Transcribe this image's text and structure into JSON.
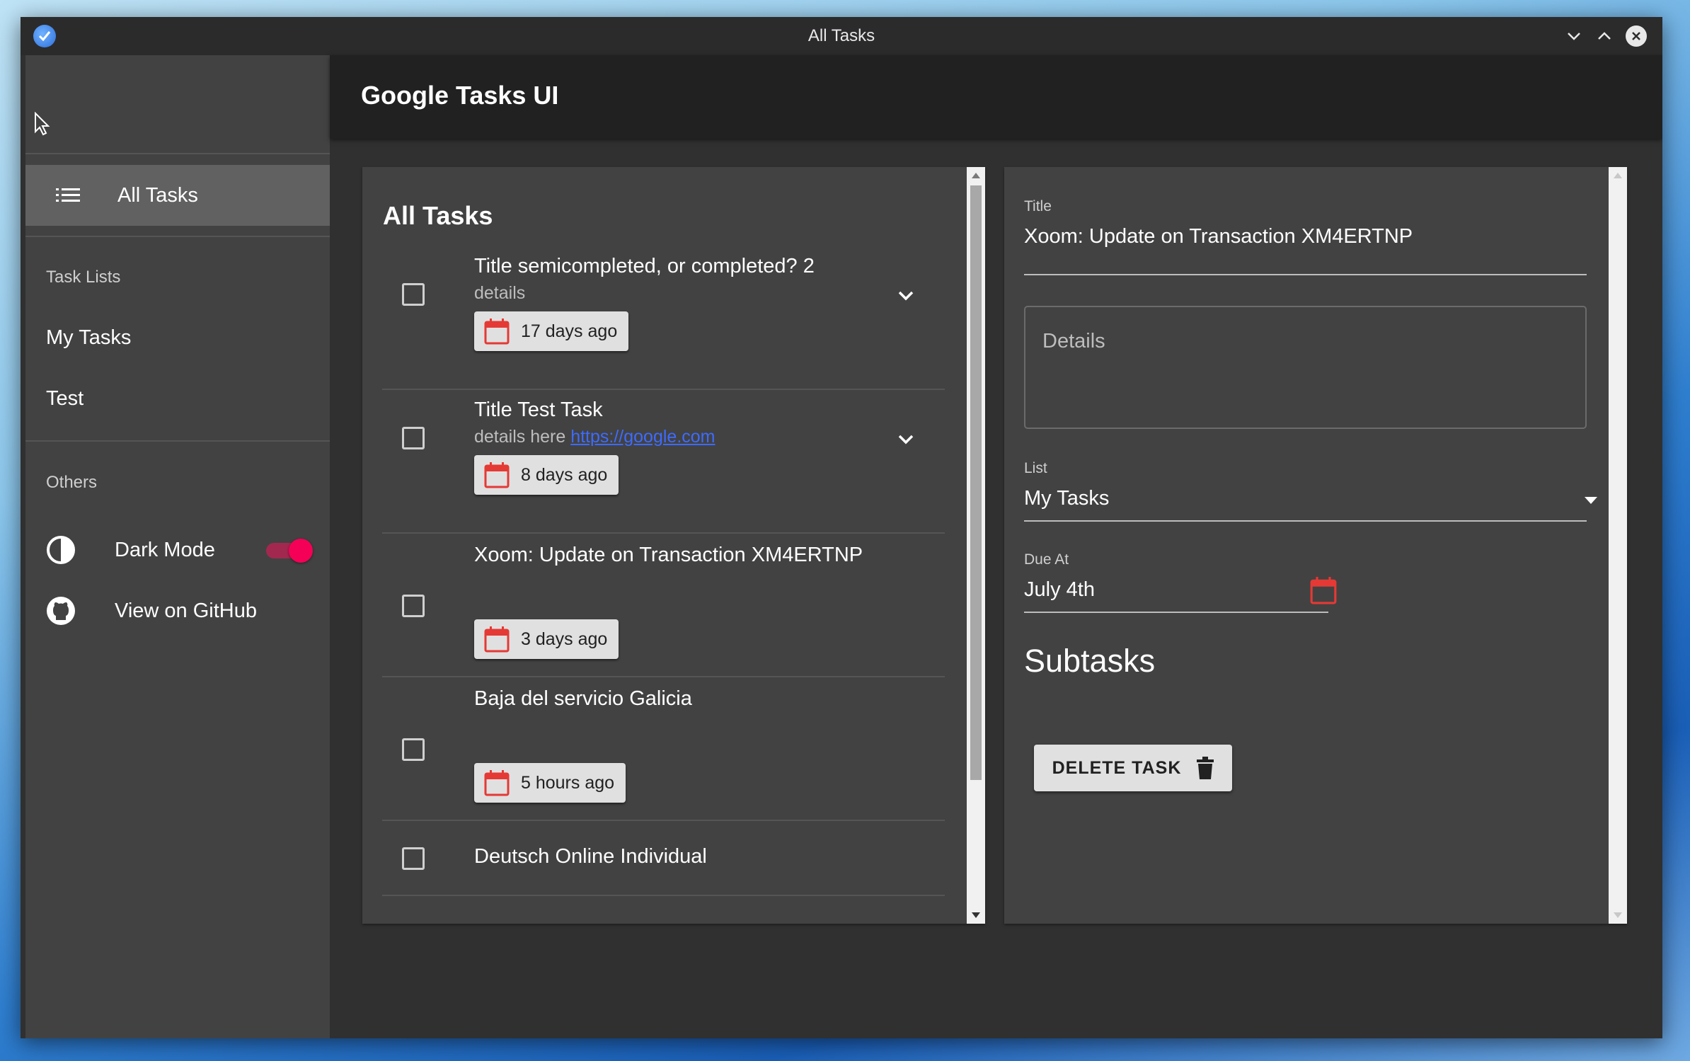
{
  "window": {
    "title": "All Tasks"
  },
  "app": {
    "title": "Google Tasks UI"
  },
  "sidebar": {
    "all_tasks": "All Tasks",
    "task_lists_header": "Task Lists",
    "lists": [
      "My Tasks",
      "Test"
    ],
    "others_header": "Others",
    "dark_mode": "Dark Mode",
    "dark_mode_on": true,
    "github": "View on GitHub"
  },
  "tasks": {
    "heading": "All Tasks",
    "items": [
      {
        "title": "Title semicompleted, or completed? 2",
        "details": "details",
        "link": "",
        "due": "17 days ago"
      },
      {
        "title": "Title Test Task",
        "details": "details here ",
        "link": "https://google.com",
        "due": "8 days ago"
      },
      {
        "title": "Xoom: Update on Transaction XM4ERTNP",
        "details": "",
        "link": "",
        "due": "3 days ago"
      },
      {
        "title": "Baja del servicio Galicia",
        "details": "",
        "link": "",
        "due": "5 hours ago"
      },
      {
        "title": "Deutsch Online Individual",
        "details": "",
        "link": "",
        "due": ""
      }
    ]
  },
  "details": {
    "title_label": "Title",
    "title_value": "Xoom: Update on Transaction XM4ERTNP",
    "details_placeholder": "Details",
    "list_label": "List",
    "list_value": "My Tasks",
    "due_label": "Due At",
    "due_value": "July 4th",
    "subtasks_heading": "Subtasks",
    "delete_label": "DELETE TASK"
  },
  "colors": {
    "accent": "#f50057",
    "calendar": "#e53935",
    "link": "#3d6bff"
  }
}
